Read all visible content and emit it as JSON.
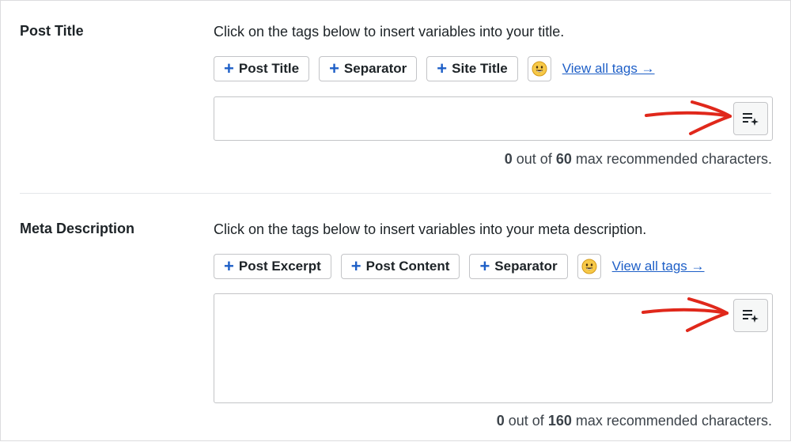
{
  "post_title": {
    "label": "Post Title",
    "instruction": "Click on the tags below to insert variables into your title.",
    "tags": [
      "Post Title",
      "Separator",
      "Site Title"
    ],
    "view_all": "View all tags →",
    "value": "",
    "counter": {
      "current": "0",
      "mid": "out of",
      "max": "60",
      "suffix": "max recommended characters."
    }
  },
  "meta_description": {
    "label": "Meta Description",
    "instruction": "Click on the tags below to insert variables into your meta description.",
    "tags": [
      "Post Excerpt",
      "Post Content",
      "Separator"
    ],
    "view_all": "View all tags →",
    "value": "",
    "counter": {
      "current": "0",
      "mid": "out of",
      "max": "160",
      "suffix": "max recommended characters."
    }
  },
  "icons": {
    "tag_plus": "plus-icon",
    "emoji": "smiley-emoji-icon",
    "ai": "ai-sparkle-list-icon",
    "annotation": "red-hand-drawn-arrow"
  },
  "colors": {
    "accent": "#1e5fc7",
    "annotation": "#e0281b",
    "border": "#c3c4c7",
    "text": "#1d2327"
  }
}
